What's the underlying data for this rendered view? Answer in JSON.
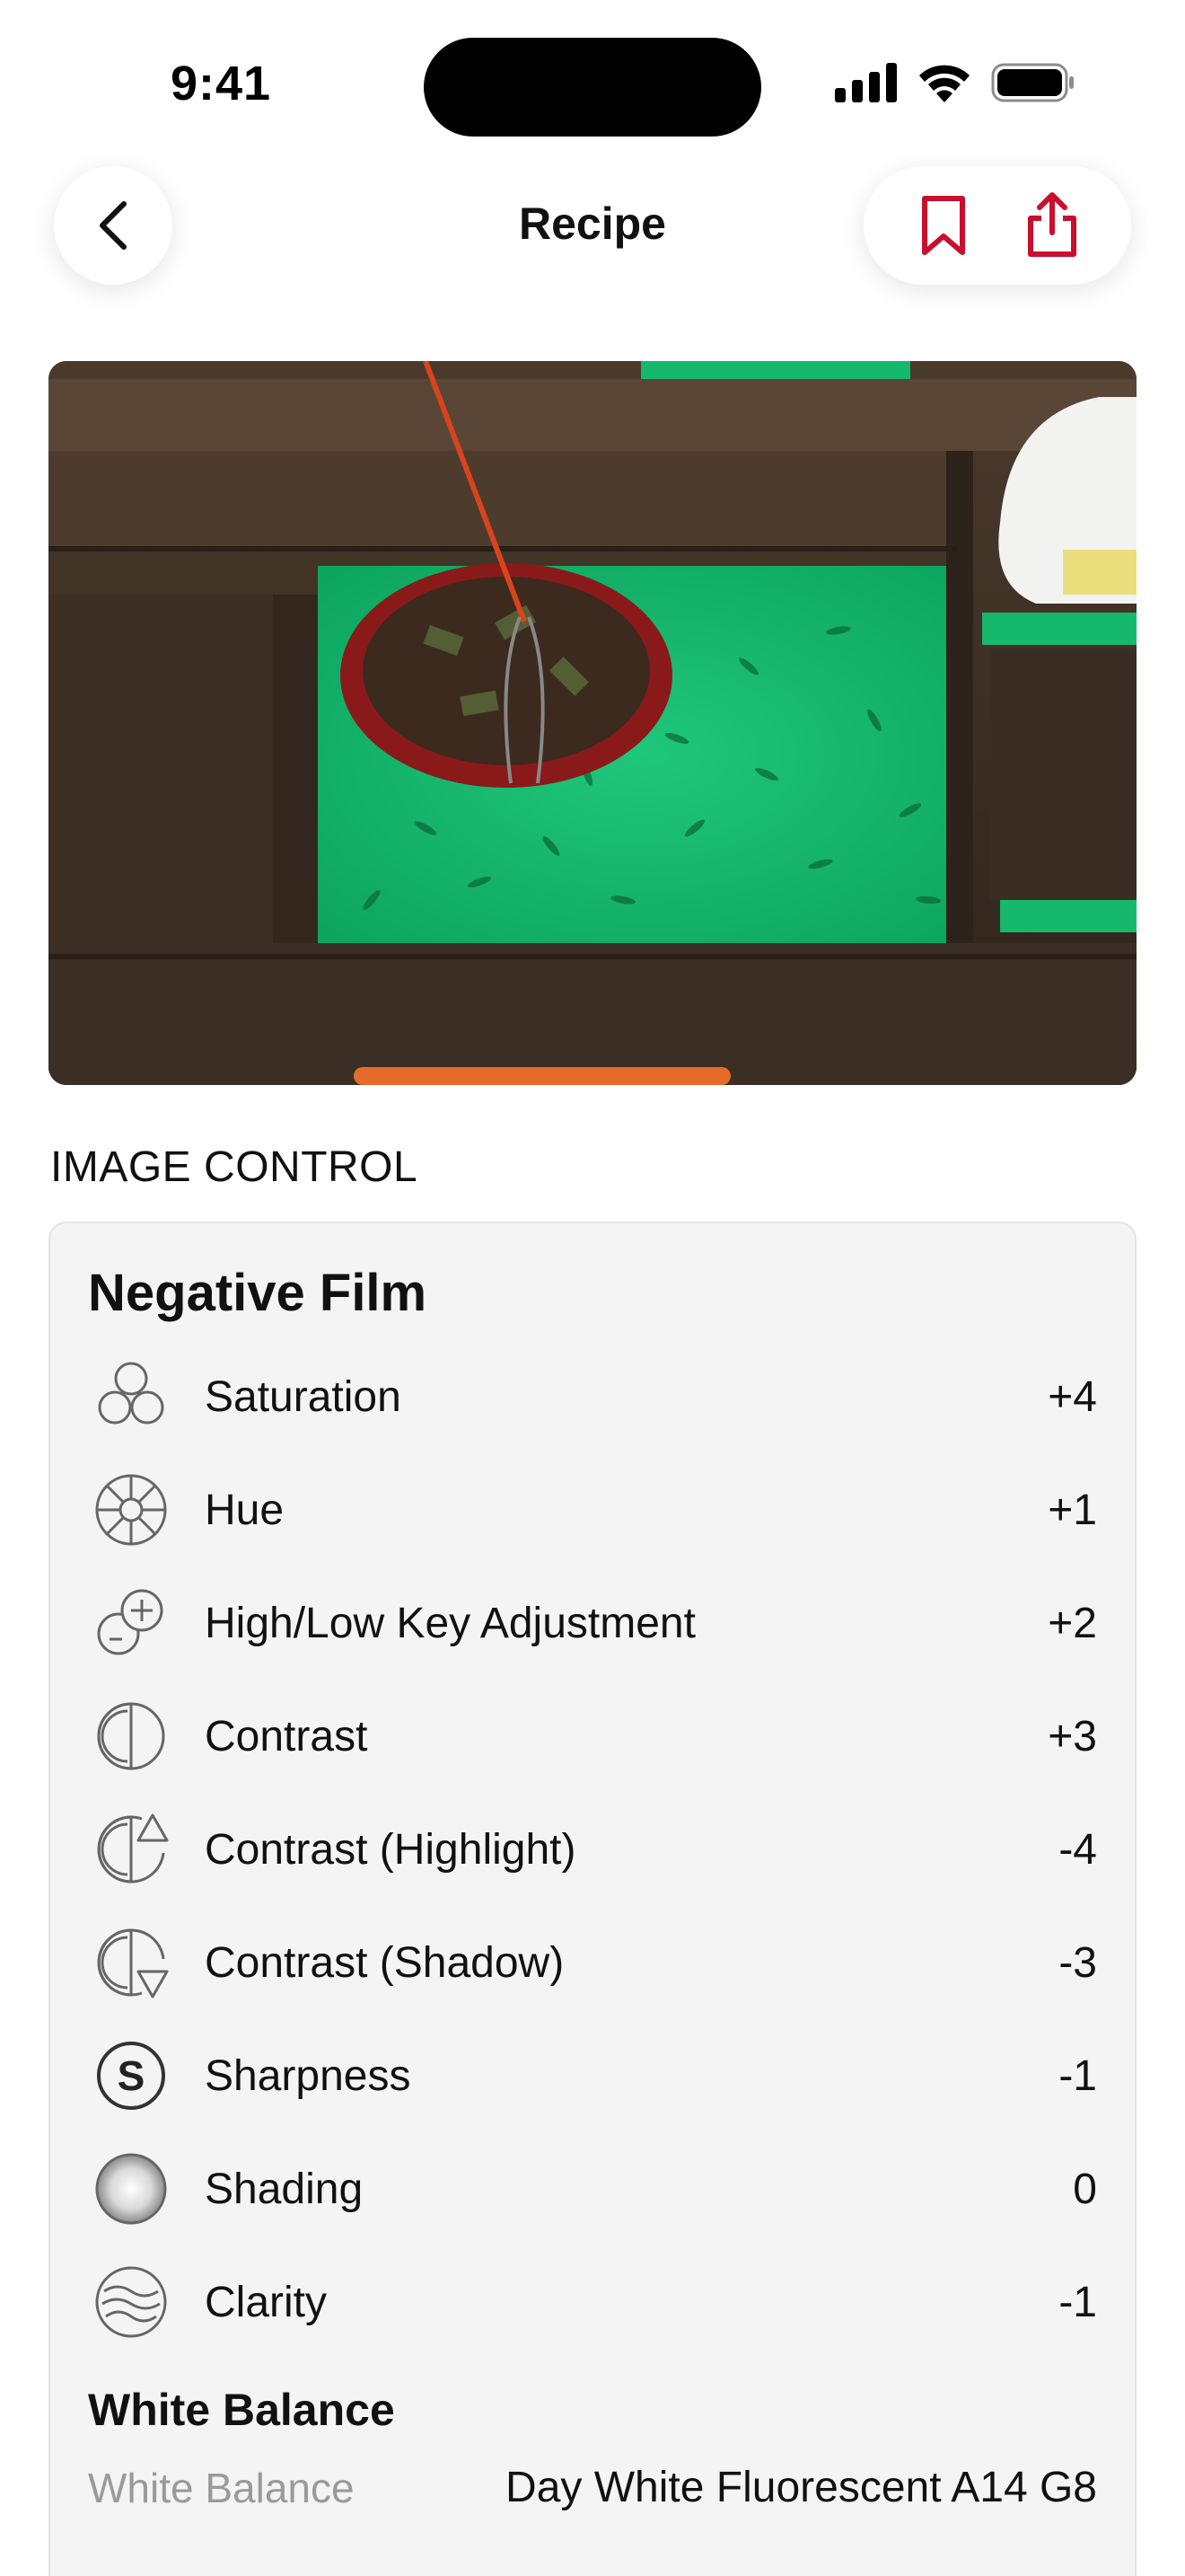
{
  "status": {
    "time": "9:41"
  },
  "nav": {
    "title": "Recipe"
  },
  "photo": {
    "description_icon": "photo-image"
  },
  "section": {
    "header": "IMAGE CONTROL"
  },
  "recipe": {
    "name": "Negative Film",
    "settings": [
      {
        "icon": "saturation-icon",
        "label": "Saturation",
        "value": "+4"
      },
      {
        "icon": "hue-icon",
        "label": "Hue",
        "value": "+1"
      },
      {
        "icon": "high-low-key-icon",
        "label": "High/Low Key Adjustment",
        "value": "+2"
      },
      {
        "icon": "contrast-icon",
        "label": "Contrast",
        "value": "+3"
      },
      {
        "icon": "contrast-highlight-icon",
        "label": "Contrast (Highlight)",
        "value": "-4"
      },
      {
        "icon": "contrast-shadow-icon",
        "label": "Contrast (Shadow)",
        "value": "-3"
      },
      {
        "icon": "sharpness-icon",
        "label": "Sharpness",
        "value": "-1"
      },
      {
        "icon": "shading-icon",
        "label": "Shading",
        "value": "0"
      },
      {
        "icon": "clarity-icon",
        "label": "Clarity",
        "value": "-1"
      }
    ],
    "white_balance": {
      "title": "White Balance",
      "label": "White Balance",
      "value": "Day White Fluorescent A14 G8"
    }
  },
  "colors": {
    "accent": "#c8102e",
    "card_bg": "#f4f4f4",
    "secondary_text": "#9a9a9a"
  }
}
